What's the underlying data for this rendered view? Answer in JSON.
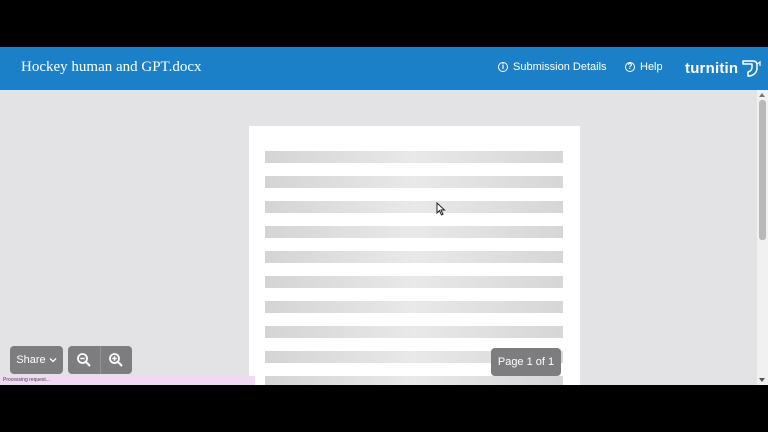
{
  "header": {
    "document_title": "Hockey human and GPT.docx",
    "submission_details_label": "Submission Details",
    "help_label": "Help",
    "brand": "turnitin",
    "info_icon_glyph": "i",
    "help_icon_glyph": "?"
  },
  "page": {
    "placeholder_line_count": 10
  },
  "toolbar": {
    "share_label": "Share",
    "zoom_out_icon": "zoom-out-icon",
    "zoom_in_icon": "zoom-in-icon"
  },
  "page_indicator": "Page 1 of 1",
  "status_text": "Processing request...",
  "colors": {
    "header": "#1b80c8",
    "canvas": "#e3e2e4",
    "button": "#7d7d7f",
    "status_bar": "#f0d9f2"
  }
}
